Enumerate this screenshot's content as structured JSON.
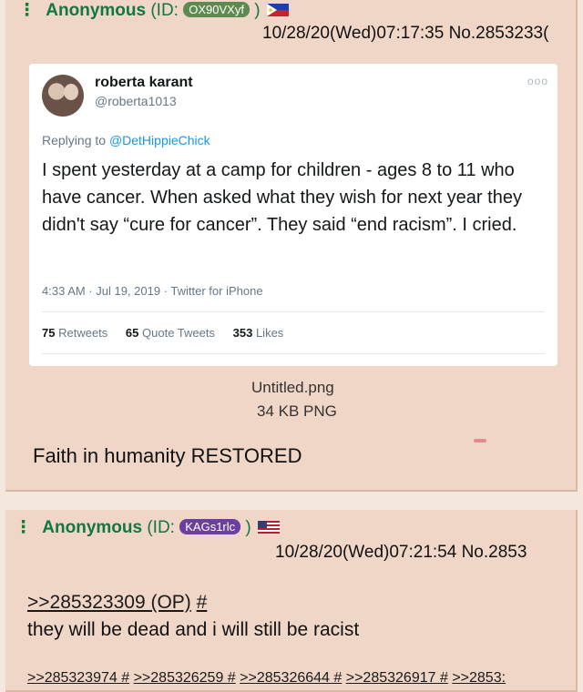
{
  "post1": {
    "menu_icon": "⋮",
    "name": "Anonymous",
    "id_prefix": "(ID:",
    "id_value": "OX90VXyf",
    "id_suffix": ")",
    "flag": "philippines-flag",
    "datetime": "10/28/20(Wed)07:17:35 No.2853233(",
    "tweet": {
      "display_name": "roberta karant",
      "handle": "@roberta1013",
      "more_icon": "ooo",
      "replying_to_label": "Replying to",
      "replying_to_user": "@DetHippieChick",
      "text": "I spent yesterday at a camp for children - ages 8 to 11 who have cancer.  When asked what they wish for next year they didn't say “cure for cancer”. They said “end racism”. I cried.",
      "meta": "4:33 AM · Jul 19, 2019 · Twitter for iPhone",
      "retweets_count": "75",
      "retweets_label": "Retweets",
      "quote_count": "65",
      "quote_label": "Quote Tweets",
      "likes_count": "353",
      "likes_label": "Likes"
    },
    "file_name": "Untitled.png",
    "file_size": "34 KB PNG",
    "text": "Faith in humanity RESTORED"
  },
  "post2": {
    "menu_icon": "⋮",
    "name": "Anonymous",
    "id_prefix": "(ID:",
    "id_value": "KAGs1rlc",
    "id_suffix": ")",
    "flag": "us-flag",
    "datetime": "10/28/20(Wed)07:21:54 No.2853",
    "quote_link": ">>285323309 (OP)",
    "quote_hash": "#",
    "text": "they will be dead and i will still be racist",
    "backlinks": [
      ">>285323974 #",
      ">>285326259 #",
      ">>285326644 #",
      ">>285326917 #",
      ">>2853:"
    ]
  },
  "colors": {
    "post_bg": "#efd6c7",
    "name_green": "#117743",
    "id1_badge": "#5c8a4f",
    "id2_badge": "#6b3fa0",
    "page_bg": "#f4e7dd"
  }
}
